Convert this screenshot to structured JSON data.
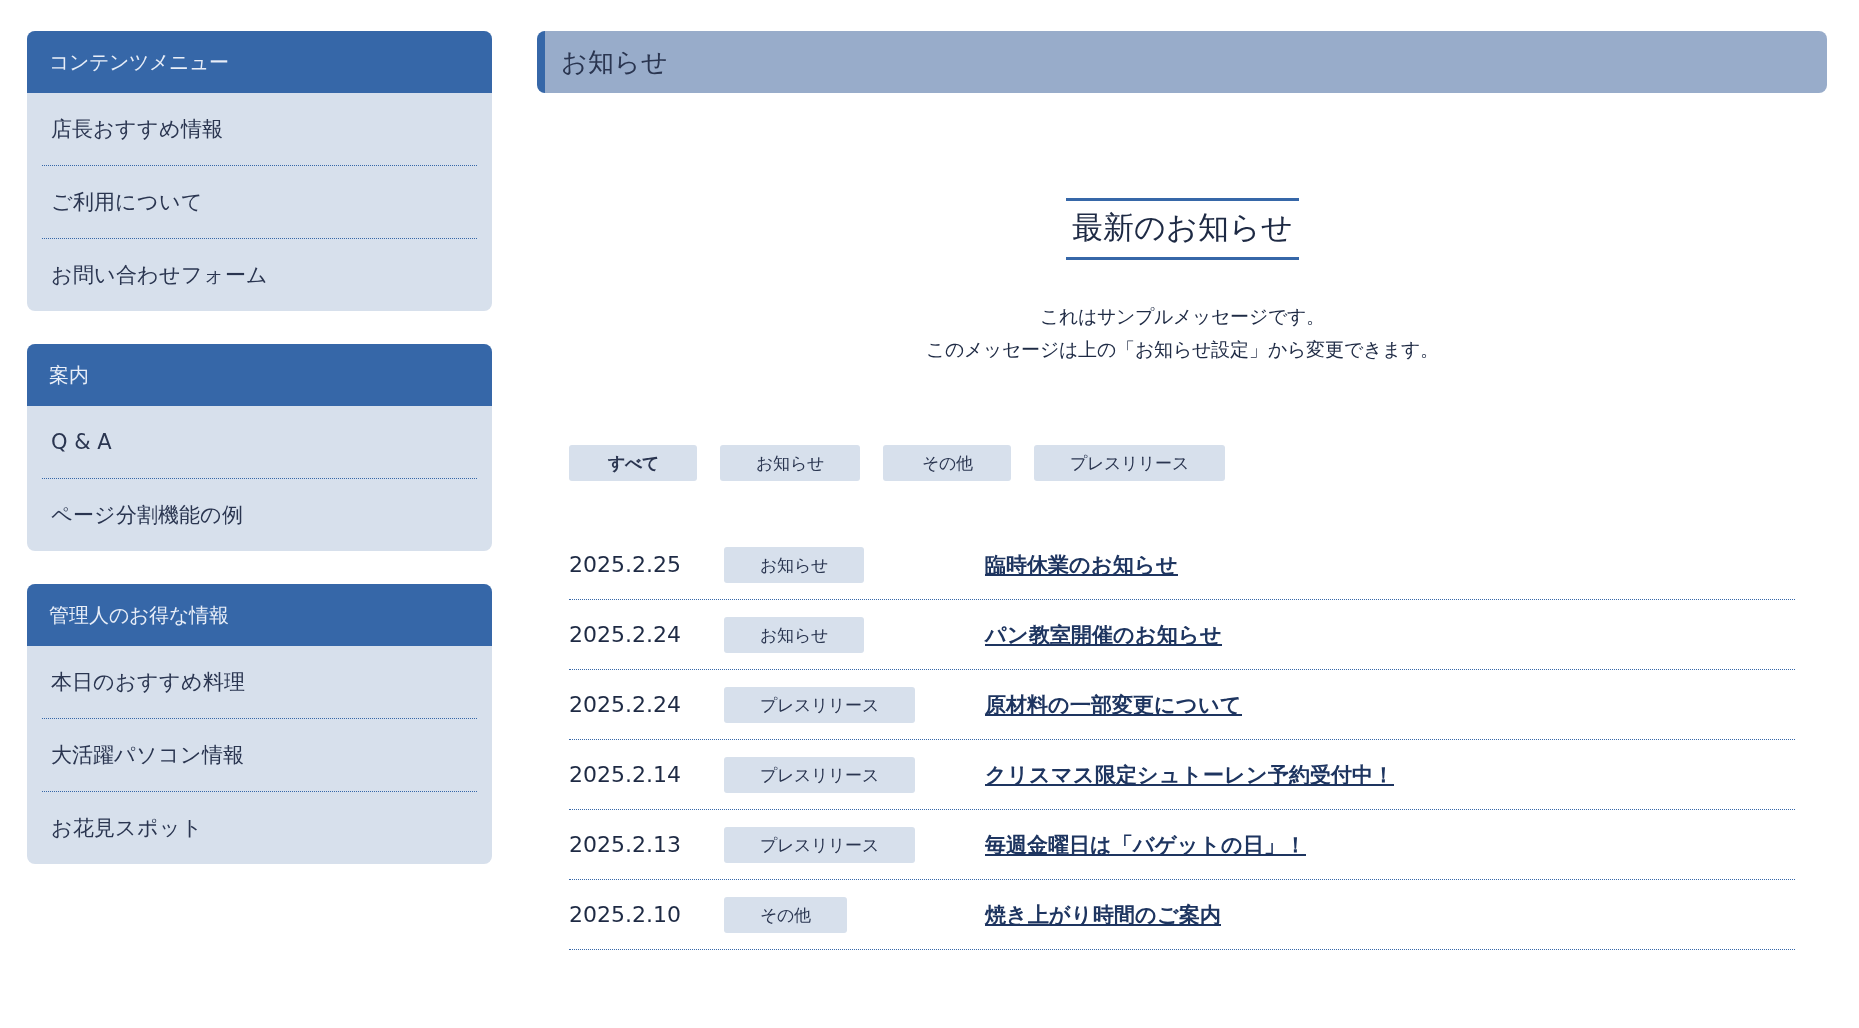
{
  "sidebar": [
    {
      "title": "コンテンツメニュー",
      "items": [
        "店長おすすめ情報",
        "ご利用について",
        "お問い合わせフォーム"
      ]
    },
    {
      "title": "案内",
      "items": [
        "Q & A",
        "ページ分割機能の例"
      ]
    },
    {
      "title": "管理人のお得な情報",
      "items": [
        "本日のおすすめ料理",
        "大活躍パソコン情報",
        "お花見スポット"
      ]
    }
  ],
  "page_title": "お知らせ",
  "section_title": "最新のお知らせ",
  "message": [
    "これはサンプルメッセージです。",
    "このメッセージは上の「お知らせ設定」から変更できます。"
  ],
  "filters": [
    {
      "label": "すべて",
      "selected": true
    },
    {
      "label": "お知らせ",
      "selected": false
    },
    {
      "label": "その他",
      "selected": false
    },
    {
      "label": "プレスリリース",
      "selected": false
    }
  ],
  "news": [
    {
      "date": "2025.2.25",
      "category": "お知らせ",
      "title": "臨時休業のお知らせ"
    },
    {
      "date": "2025.2.24",
      "category": "お知らせ",
      "title": "パン教室開催のお知らせ"
    },
    {
      "date": "2025.2.24",
      "category": "プレスリリース",
      "title": "原材料の一部変更について"
    },
    {
      "date": "2025.2.14",
      "category": "プレスリリース",
      "title": "クリスマス限定シュトーレン予約受付中！"
    },
    {
      "date": "2025.2.13",
      "category": "プレスリリース",
      "title": "毎週金曜日は「バゲットの日」！"
    },
    {
      "date": "2025.2.10",
      "category": "その他",
      "title": "焼き上がり時間のご案内"
    }
  ]
}
